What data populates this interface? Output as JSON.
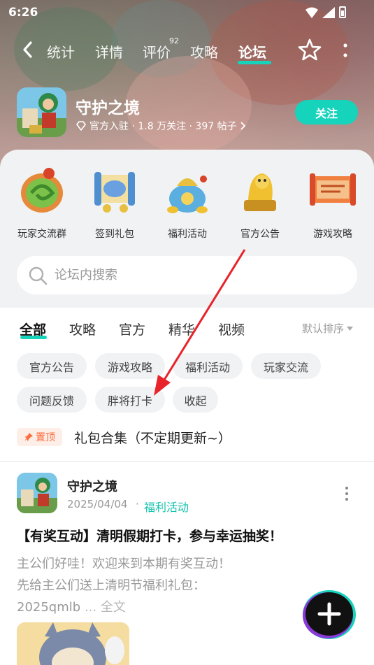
{
  "status": {
    "time": "6:26"
  },
  "nav": {
    "tabs": [
      {
        "label": "统计"
      },
      {
        "label": "详情"
      },
      {
        "label": "评价"
      },
      {
        "label": "攻略"
      },
      {
        "label": "论坛"
      }
    ],
    "review_count": "92",
    "active_tab": "论坛"
  },
  "game": {
    "title": "守护之境",
    "meta": "官方入驻 · 1.8 万关注 · 397 帖子",
    "follow_label": "关注"
  },
  "shortcuts": [
    {
      "label": "玩家交流群",
      "icon": "jade-dragon-icon"
    },
    {
      "label": "签到礼包",
      "icon": "scroll-gift-icon"
    },
    {
      "label": "福利活动",
      "icon": "treasure-bag-icon"
    },
    {
      "label": "官方公告",
      "icon": "golden-lion-icon"
    },
    {
      "label": "游戏攻略",
      "icon": "strategy-scroll-icon"
    }
  ],
  "search": {
    "placeholder": "论坛内搜索"
  },
  "category_tabs": [
    {
      "label": "全部"
    },
    {
      "label": "攻略"
    },
    {
      "label": "官方"
    },
    {
      "label": "精华"
    },
    {
      "label": "视频"
    }
  ],
  "sort_label": "默认排序",
  "chips": [
    {
      "label": "官方公告"
    },
    {
      "label": "游戏攻略"
    },
    {
      "label": "福利活动"
    },
    {
      "label": "玩家交流"
    },
    {
      "label": "问题反馈"
    },
    {
      "label": "胖将打卡"
    },
    {
      "label": "收起"
    }
  ],
  "pinned": {
    "badge": "置顶",
    "title": "礼包合集（不定期更新~）"
  },
  "post": {
    "author": "守护之境",
    "date": "2025/04/04",
    "separator": "·",
    "category": "福利活动",
    "title": "【有奖互动】清明假期打卡，参与幸运抽奖！",
    "body_line1": "主公们好哇！欢迎来到本期有奖互动！",
    "body_line2": "先给主公们送上清明节福利礼包：",
    "body_line3_code": "2025qmlb",
    "body_line3_more": "... 全文"
  },
  "colors": {
    "accent": "#16d3bc",
    "pin_orange": "#ff6a3d",
    "arrow_red": "#e8232a"
  }
}
